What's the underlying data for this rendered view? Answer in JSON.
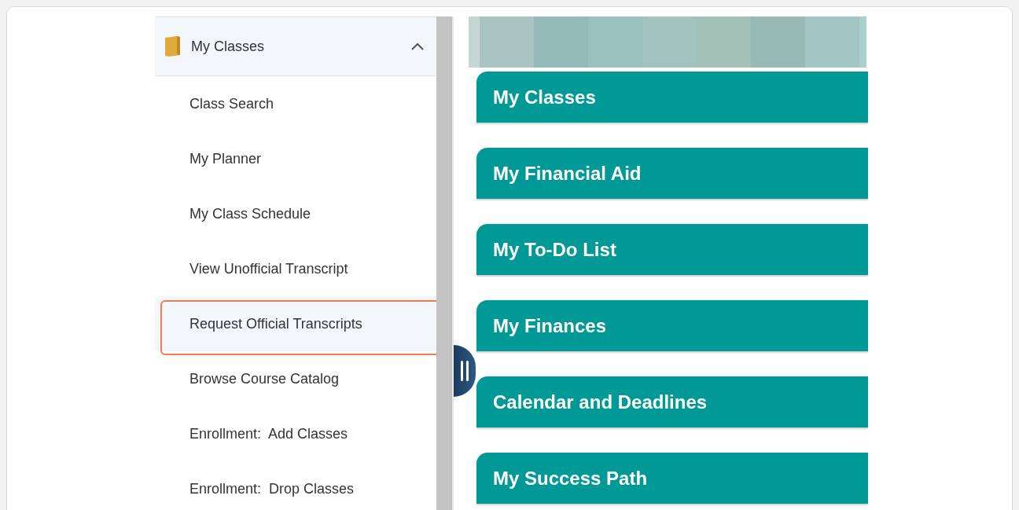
{
  "sidebar": {
    "header": {
      "label": "My Classes",
      "expanded": true
    },
    "items": [
      {
        "label": "Class Search",
        "selected": false
      },
      {
        "label": "My Planner",
        "selected": false
      },
      {
        "label": "My Class Schedule",
        "selected": false
      },
      {
        "label": "View Unofficial Transcript",
        "selected": false
      },
      {
        "label": "Request Official Transcripts",
        "selected": true
      },
      {
        "label": "Browse Course Catalog",
        "selected": false
      },
      {
        "label": "Enrollment:  Add Classes",
        "selected": false
      },
      {
        "label": "Enrollment:  Drop Classes",
        "selected": false
      }
    ]
  },
  "tiles": [
    {
      "title": "My Classes"
    },
    {
      "title": "My Financial Aid"
    },
    {
      "title": "My To-Do List"
    },
    {
      "title": "My Finances"
    },
    {
      "title": "Calendar and Deadlines"
    },
    {
      "title": "My Success Path"
    }
  ]
}
